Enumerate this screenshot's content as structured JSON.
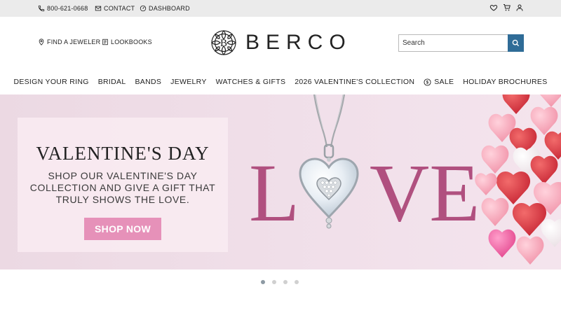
{
  "topbar": {
    "phone": "800-621-0668",
    "contact": "CONTACT",
    "dashboard": "DASHBOARD"
  },
  "header": {
    "find_jeweler": "FIND A JEWELER",
    "lookbooks": "LOOKBOOKS",
    "logo_text": "BERCO",
    "search_placeholder": "Search"
  },
  "nav": {
    "items": [
      "DESIGN YOUR RING",
      "BRIDAL",
      "BANDS",
      "JEWELRY",
      "WATCHES & GIFTS",
      "2026 VALENTINE'S COLLECTION",
      "SALE",
      "HOLIDAY BROCHURES"
    ]
  },
  "hero": {
    "title": "VALENTINE'S DAY",
    "subtitle": "SHOP OUR VALENTINE'S DAY COLLECTION AND GIVE A GIFT THAT TRULY SHOWS THE LOVE.",
    "cta": "SHOP NOW",
    "love_word_left": "L",
    "love_word_right": "VE"
  },
  "carousel": {
    "slides": 4,
    "active": 1
  },
  "colors": {
    "accent_blue": "#2f6c97",
    "cta_pink": "#e691b9",
    "love_text": "#b0507f",
    "hero_bg": "#efdde7"
  }
}
